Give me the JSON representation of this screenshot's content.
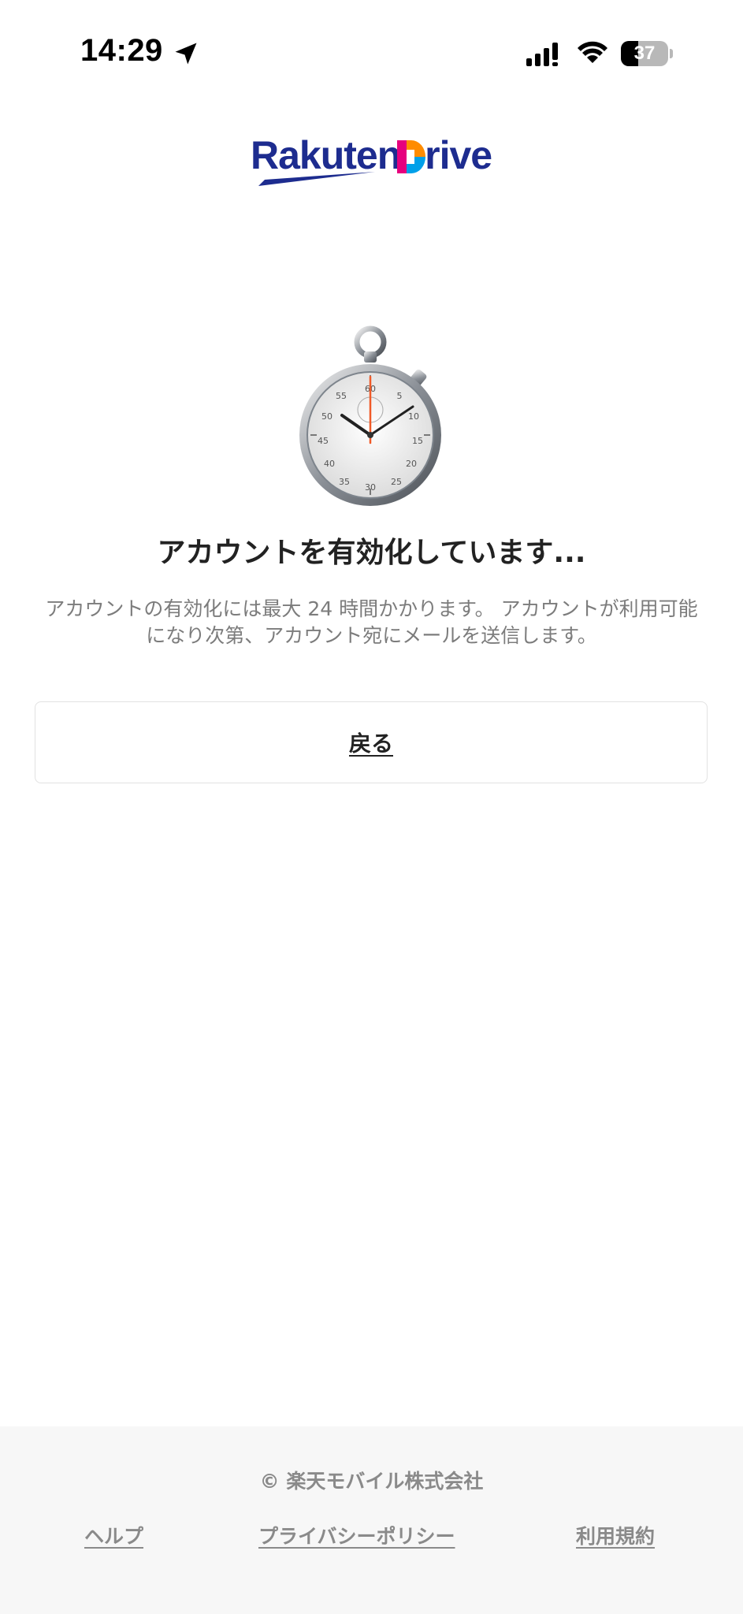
{
  "status_bar": {
    "time": "14:29",
    "battery": "37",
    "battery_level": 0.37,
    "icons": [
      "location-arrow-icon",
      "cellular-signal-icon",
      "wifi-icon",
      "battery-icon"
    ]
  },
  "logo": {
    "rakuten": "Rakuten",
    "drive": "Drive",
    "brand_color": "#1d2c8f"
  },
  "main": {
    "illustration": "stopwatch-icon",
    "heading": "アカウントを有効化しています...",
    "description": "アカウントの有効化には最大 24 時間かかります。 アカウントが利用可能になり次第、アカウント宛にメールを送信します。",
    "back_button_label": "戻る"
  },
  "footer": {
    "copyright": "© 楽天モバイル株式会社",
    "links": [
      {
        "label": "ヘルプ"
      },
      {
        "label": "プライバシーポリシー"
      },
      {
        "label": "利用規約"
      }
    ]
  }
}
